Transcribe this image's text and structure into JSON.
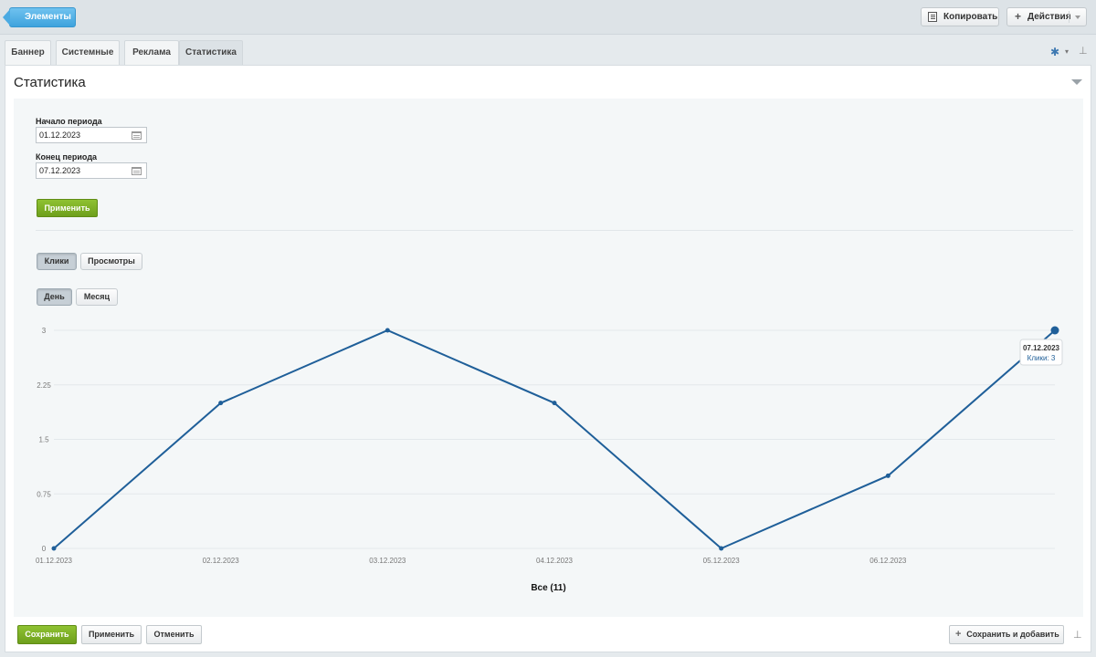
{
  "toolbar": {
    "back_label": "Элементы",
    "copy_label": "Копировать",
    "actions_label": "Действия"
  },
  "tabs": [
    {
      "label": "Баннер",
      "active": false
    },
    {
      "label": "Системные",
      "active": false
    },
    {
      "label": "Реклама",
      "active": false
    },
    {
      "label": "Статистика",
      "active": true
    }
  ],
  "section": {
    "title": "Статистика"
  },
  "filter": {
    "start_label": "Начало периода",
    "start_value": "01.12.2023",
    "end_label": "Конец периода",
    "end_value": "07.12.2023",
    "apply_label": "Применить"
  },
  "metric_toggle": {
    "options": [
      "Клики",
      "Просмотры"
    ],
    "selected": "Клики"
  },
  "period_toggle": {
    "options": [
      "День",
      "Месяц"
    ],
    "selected": "День"
  },
  "chart_data": {
    "type": "line",
    "x": [
      "01.12.2023",
      "02.12.2023",
      "03.12.2023",
      "04.12.2023",
      "05.12.2023",
      "06.12.2023",
      "07.12.2023"
    ],
    "series": [
      {
        "name": "Клики",
        "values": [
          0,
          2,
          3,
          2,
          0,
          1,
          3
        ],
        "color": "#1f5f99"
      }
    ],
    "y_ticks": [
      "0",
      "0.75",
      "1.5",
      "2.25",
      "3"
    ],
    "ylim": [
      0,
      3
    ],
    "grid": true,
    "tooltip": {
      "date": "07.12.2023",
      "text": "Клики: 3"
    },
    "total_label": "Все (11)"
  },
  "footer": {
    "save_label": "Сохранить",
    "apply_label": "Применить",
    "cancel_label": "Отменить",
    "save_add_label": "Сохранить и добавить"
  },
  "colors": {
    "accent_blue": "#3fa3dd",
    "accent_green": "#7aab22",
    "line": "#1f5f99"
  }
}
